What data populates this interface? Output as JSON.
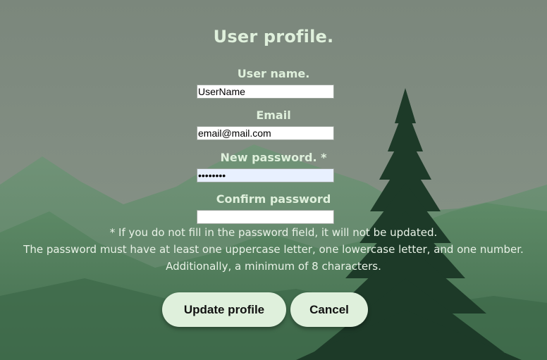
{
  "page": {
    "title": "User profile."
  },
  "form": {
    "username": {
      "label": "User name.",
      "value": "UserName"
    },
    "email": {
      "label": "Email",
      "value": "email@mail.com"
    },
    "new_password": {
      "label": "New password. *",
      "value": "password"
    },
    "confirm_password": {
      "label": "Confirm password",
      "value": ""
    }
  },
  "notes": {
    "line1": "* If you do not fill in the password field, it will not be updated.",
    "line2": "The password must have at least one uppercase letter, one lowercase letter, and one number.",
    "line3": "Additionally, a minimum of 8 characters."
  },
  "buttons": {
    "update_label": "Update profile",
    "cancel_label": "Cancel"
  },
  "colors": {
    "heading": "#dff0dc",
    "button_bg": "#dff0dc",
    "tree": "#1d3a28",
    "mountain": "#5e8a67"
  }
}
